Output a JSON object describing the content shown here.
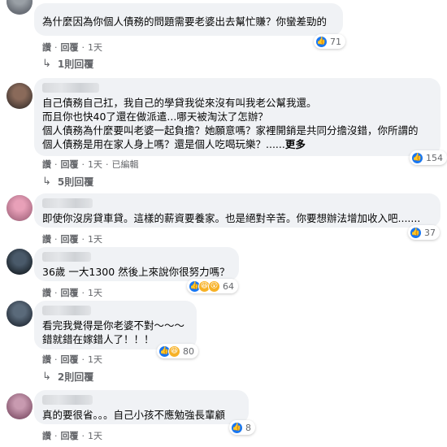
{
  "comments": [
    {
      "text": "為什麼因為你個人債務的問題需要老婆出去幫忙賺？你蠻差勁的",
      "reaction_count": "71",
      "reactions": [
        "like-icon"
      ],
      "actions": {
        "like": "讚",
        "reply": "回覆",
        "time": "1天"
      },
      "replies_label": "1則回覆"
    },
    {
      "text": "自己債務自己扛，我自己的學貸我從來沒有叫我老公幫我還。\n而且你也快40了還在做派遣...哪天被淘汰了怎辦？\n個人債務為什麼要叫老婆一起負擔？她願意嗎？家裡開銷是共同分擔沒錯，你所謂的\n個人債務是用在家人身上嗎？還是個人吃喝玩樂？......",
      "more_label": "更多",
      "reaction_count": "154",
      "reactions": [
        "like-icon"
      ],
      "actions": {
        "like": "讚",
        "reply": "回覆",
        "time": "1天",
        "edited": "已編輯"
      },
      "replies_label": "5則回覆"
    },
    {
      "text": "即使你沒房貸車貸。這樣的薪資要養家。也是絕對辛苦。你要想辦法增加收入吧.......",
      "reaction_count": "37",
      "reactions": [
        "like-icon"
      ],
      "actions": {
        "like": "讚",
        "reply": "回覆",
        "time": "1天"
      }
    },
    {
      "text": "36歲 一大1300 然後上來說你很努力嗎？",
      "reaction_count": "64",
      "reactions": [
        "like-icon",
        "haha-icon",
        "sad-icon"
      ],
      "actions": {
        "like": "讚",
        "reply": "回覆",
        "time": "1天"
      }
    },
    {
      "text": "看完我覺得是你老婆不對～～～\n錯就錯在嫁錯人了！！！",
      "reaction_count": "80",
      "reactions": [
        "like-icon",
        "haha-icon"
      ],
      "actions": {
        "like": "讚",
        "reply": "回覆",
        "time": "1天"
      },
      "replies_label": "2則回覆"
    },
    {
      "text": "真的要很省。。。自己小孩不應勉強長輩顧",
      "reaction_count": "8",
      "reactions": [
        "like-icon"
      ],
      "actions": {
        "like": "讚",
        "reply": "回覆",
        "time": "1天"
      }
    }
  ],
  "colors": {
    "bubble": "#f0f2f5",
    "like": "#1877f2",
    "secondary_text": "#65676b"
  }
}
